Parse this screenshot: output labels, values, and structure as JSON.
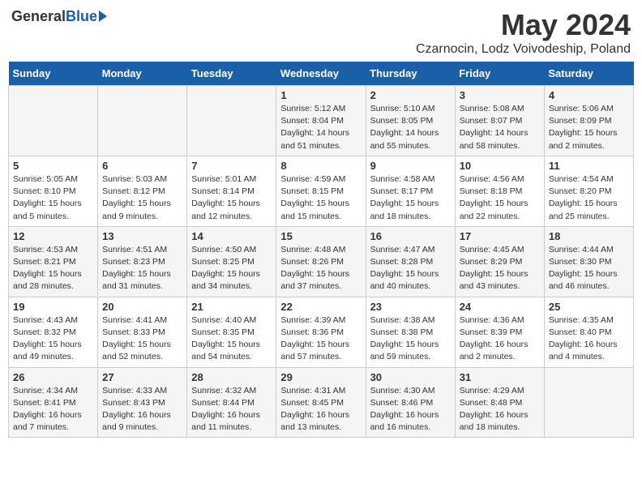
{
  "logo": {
    "general": "General",
    "blue": "Blue"
  },
  "title": "May 2024",
  "subtitle": "Czarnocin, Lodz Voivodeship, Poland",
  "days_header": [
    "Sunday",
    "Monday",
    "Tuesday",
    "Wednesday",
    "Thursday",
    "Friday",
    "Saturday"
  ],
  "weeks": [
    [
      {
        "day": "",
        "info": ""
      },
      {
        "day": "",
        "info": ""
      },
      {
        "day": "",
        "info": ""
      },
      {
        "day": "1",
        "info": "Sunrise: 5:12 AM\nSunset: 8:04 PM\nDaylight: 14 hours and 51 minutes."
      },
      {
        "day": "2",
        "info": "Sunrise: 5:10 AM\nSunset: 8:05 PM\nDaylight: 14 hours and 55 minutes."
      },
      {
        "day": "3",
        "info": "Sunrise: 5:08 AM\nSunset: 8:07 PM\nDaylight: 14 hours and 58 minutes."
      },
      {
        "day": "4",
        "info": "Sunrise: 5:06 AM\nSunset: 8:09 PM\nDaylight: 15 hours and 2 minutes."
      }
    ],
    [
      {
        "day": "5",
        "info": "Sunrise: 5:05 AM\nSunset: 8:10 PM\nDaylight: 15 hours and 5 minutes."
      },
      {
        "day": "6",
        "info": "Sunrise: 5:03 AM\nSunset: 8:12 PM\nDaylight: 15 hours and 9 minutes."
      },
      {
        "day": "7",
        "info": "Sunrise: 5:01 AM\nSunset: 8:14 PM\nDaylight: 15 hours and 12 minutes."
      },
      {
        "day": "8",
        "info": "Sunrise: 4:59 AM\nSunset: 8:15 PM\nDaylight: 15 hours and 15 minutes."
      },
      {
        "day": "9",
        "info": "Sunrise: 4:58 AM\nSunset: 8:17 PM\nDaylight: 15 hours and 18 minutes."
      },
      {
        "day": "10",
        "info": "Sunrise: 4:56 AM\nSunset: 8:18 PM\nDaylight: 15 hours and 22 minutes."
      },
      {
        "day": "11",
        "info": "Sunrise: 4:54 AM\nSunset: 8:20 PM\nDaylight: 15 hours and 25 minutes."
      }
    ],
    [
      {
        "day": "12",
        "info": "Sunrise: 4:53 AM\nSunset: 8:21 PM\nDaylight: 15 hours and 28 minutes."
      },
      {
        "day": "13",
        "info": "Sunrise: 4:51 AM\nSunset: 8:23 PM\nDaylight: 15 hours and 31 minutes."
      },
      {
        "day": "14",
        "info": "Sunrise: 4:50 AM\nSunset: 8:25 PM\nDaylight: 15 hours and 34 minutes."
      },
      {
        "day": "15",
        "info": "Sunrise: 4:48 AM\nSunset: 8:26 PM\nDaylight: 15 hours and 37 minutes."
      },
      {
        "day": "16",
        "info": "Sunrise: 4:47 AM\nSunset: 8:28 PM\nDaylight: 15 hours and 40 minutes."
      },
      {
        "day": "17",
        "info": "Sunrise: 4:45 AM\nSunset: 8:29 PM\nDaylight: 15 hours and 43 minutes."
      },
      {
        "day": "18",
        "info": "Sunrise: 4:44 AM\nSunset: 8:30 PM\nDaylight: 15 hours and 46 minutes."
      }
    ],
    [
      {
        "day": "19",
        "info": "Sunrise: 4:43 AM\nSunset: 8:32 PM\nDaylight: 15 hours and 49 minutes."
      },
      {
        "day": "20",
        "info": "Sunrise: 4:41 AM\nSunset: 8:33 PM\nDaylight: 15 hours and 52 minutes."
      },
      {
        "day": "21",
        "info": "Sunrise: 4:40 AM\nSunset: 8:35 PM\nDaylight: 15 hours and 54 minutes."
      },
      {
        "day": "22",
        "info": "Sunrise: 4:39 AM\nSunset: 8:36 PM\nDaylight: 15 hours and 57 minutes."
      },
      {
        "day": "23",
        "info": "Sunrise: 4:38 AM\nSunset: 8:38 PM\nDaylight: 15 hours and 59 minutes."
      },
      {
        "day": "24",
        "info": "Sunrise: 4:36 AM\nSunset: 8:39 PM\nDaylight: 16 hours and 2 minutes."
      },
      {
        "day": "25",
        "info": "Sunrise: 4:35 AM\nSunset: 8:40 PM\nDaylight: 16 hours and 4 minutes."
      }
    ],
    [
      {
        "day": "26",
        "info": "Sunrise: 4:34 AM\nSunset: 8:41 PM\nDaylight: 16 hours and 7 minutes."
      },
      {
        "day": "27",
        "info": "Sunrise: 4:33 AM\nSunset: 8:43 PM\nDaylight: 16 hours and 9 minutes."
      },
      {
        "day": "28",
        "info": "Sunrise: 4:32 AM\nSunset: 8:44 PM\nDaylight: 16 hours and 11 minutes."
      },
      {
        "day": "29",
        "info": "Sunrise: 4:31 AM\nSunset: 8:45 PM\nDaylight: 16 hours and 13 minutes."
      },
      {
        "day": "30",
        "info": "Sunrise: 4:30 AM\nSunset: 8:46 PM\nDaylight: 16 hours and 16 minutes."
      },
      {
        "day": "31",
        "info": "Sunrise: 4:29 AM\nSunset: 8:48 PM\nDaylight: 16 hours and 18 minutes."
      },
      {
        "day": "",
        "info": ""
      }
    ]
  ]
}
